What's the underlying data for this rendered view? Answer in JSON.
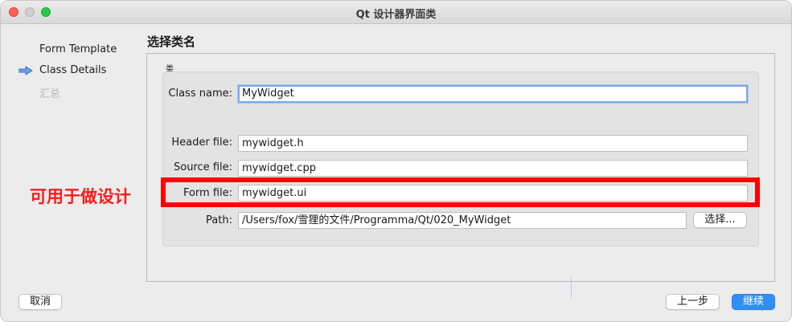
{
  "window": {
    "title": "Qt 设计器界面类"
  },
  "wizard_steps": [
    {
      "label": "Form Template",
      "state": "done"
    },
    {
      "label": "Class Details",
      "state": "current"
    },
    {
      "label": "汇总",
      "state": "disabled"
    }
  ],
  "page": {
    "title": "选择类名",
    "group_label": "类"
  },
  "fields": {
    "class_name": {
      "label": "Class name:",
      "value": "MyWidget"
    },
    "header_file": {
      "label": "Header file:",
      "value": "mywidget.h"
    },
    "source_file": {
      "label": "Source file:",
      "value": "mywidget.cpp"
    },
    "form_file": {
      "label": "Form file:",
      "value": "mywidget.ui"
    },
    "path": {
      "label": "Path:",
      "value": "/Users/fox/雪狸的文件/Programma/Qt/020_MyWidget"
    }
  },
  "buttons": {
    "browse": "选择...",
    "cancel": "取消",
    "back": "上一步",
    "continue": "继续"
  },
  "annotation": {
    "text": "可用于做设计",
    "color": "#ff0000"
  },
  "colors": {
    "accent": "#2f8ff7",
    "focus_ring": "#7fa7e6",
    "traffic_close": "#fe5f57",
    "traffic_max": "#2ac840"
  }
}
